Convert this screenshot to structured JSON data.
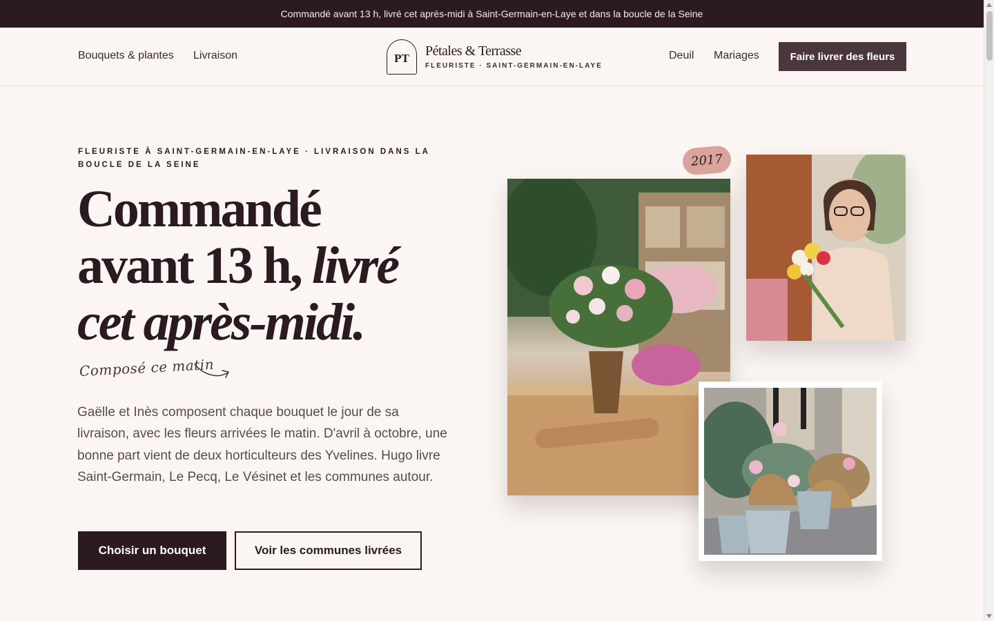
{
  "announcement": "Commandé avant 13 h, livré cet après-midi à Saint-Germain-en-Laye et dans la boucle de la Seine",
  "nav": {
    "left_links": [
      "Bouquets & plantes",
      "Livraison"
    ],
    "right_links": [
      "Deuil",
      "Mariages"
    ],
    "cta": "Faire livrer des fleurs"
  },
  "logo": {
    "mark": "PT",
    "name": "Pétales & Terrasse",
    "tagline": "FLEURISTE · SAINT-GERMAIN-EN-LAYE"
  },
  "hero": {
    "eyebrow": "FLEURISTE À SAINT-GERMAIN-EN-LAYE · LIVRAISON DANS LA BOUCLE DE LA SEINE",
    "headline_line1": "Commandé",
    "headline_line2": "avant 13 h, ",
    "headline_line2_em": "livré",
    "headline_line3": "cet après-midi.",
    "script_note": "Composé ce matin",
    "lede": "Gaëlle et Inès composent chaque bouquet le jour de sa livraison, avec les fleurs arrivées le matin. D'avril à octobre, une bonne part vient de deux horticulteurs des Yvelines. Hugo livre Saint-Germain, Le Pecq, Le Vésinet et les communes autour.",
    "primary_button": "Choisir un bouquet",
    "secondary_button": "Voir les communes livrées",
    "year_badge": "2017"
  },
  "colors": {
    "brand_dark": "#2b1a20",
    "nav_button": "#4a363c",
    "background": "#fbf6f3",
    "badge": "#d9a49b"
  },
  "icons": {
    "arrow": "curved-arrow-icon"
  }
}
